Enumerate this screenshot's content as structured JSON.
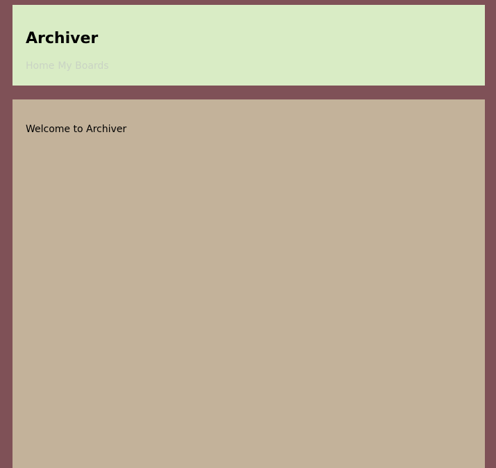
{
  "header": {
    "title": "Archiver",
    "nav": [
      {
        "label": "Home"
      },
      {
        "label": "My Boards"
      }
    ]
  },
  "main": {
    "welcome_text": "Welcome to Archiver"
  },
  "colors": {
    "page_background": "#7f5157",
    "header_background": "#d9ecc5",
    "main_background": "#c3b29a",
    "nav_link": "#c9d3c4"
  }
}
